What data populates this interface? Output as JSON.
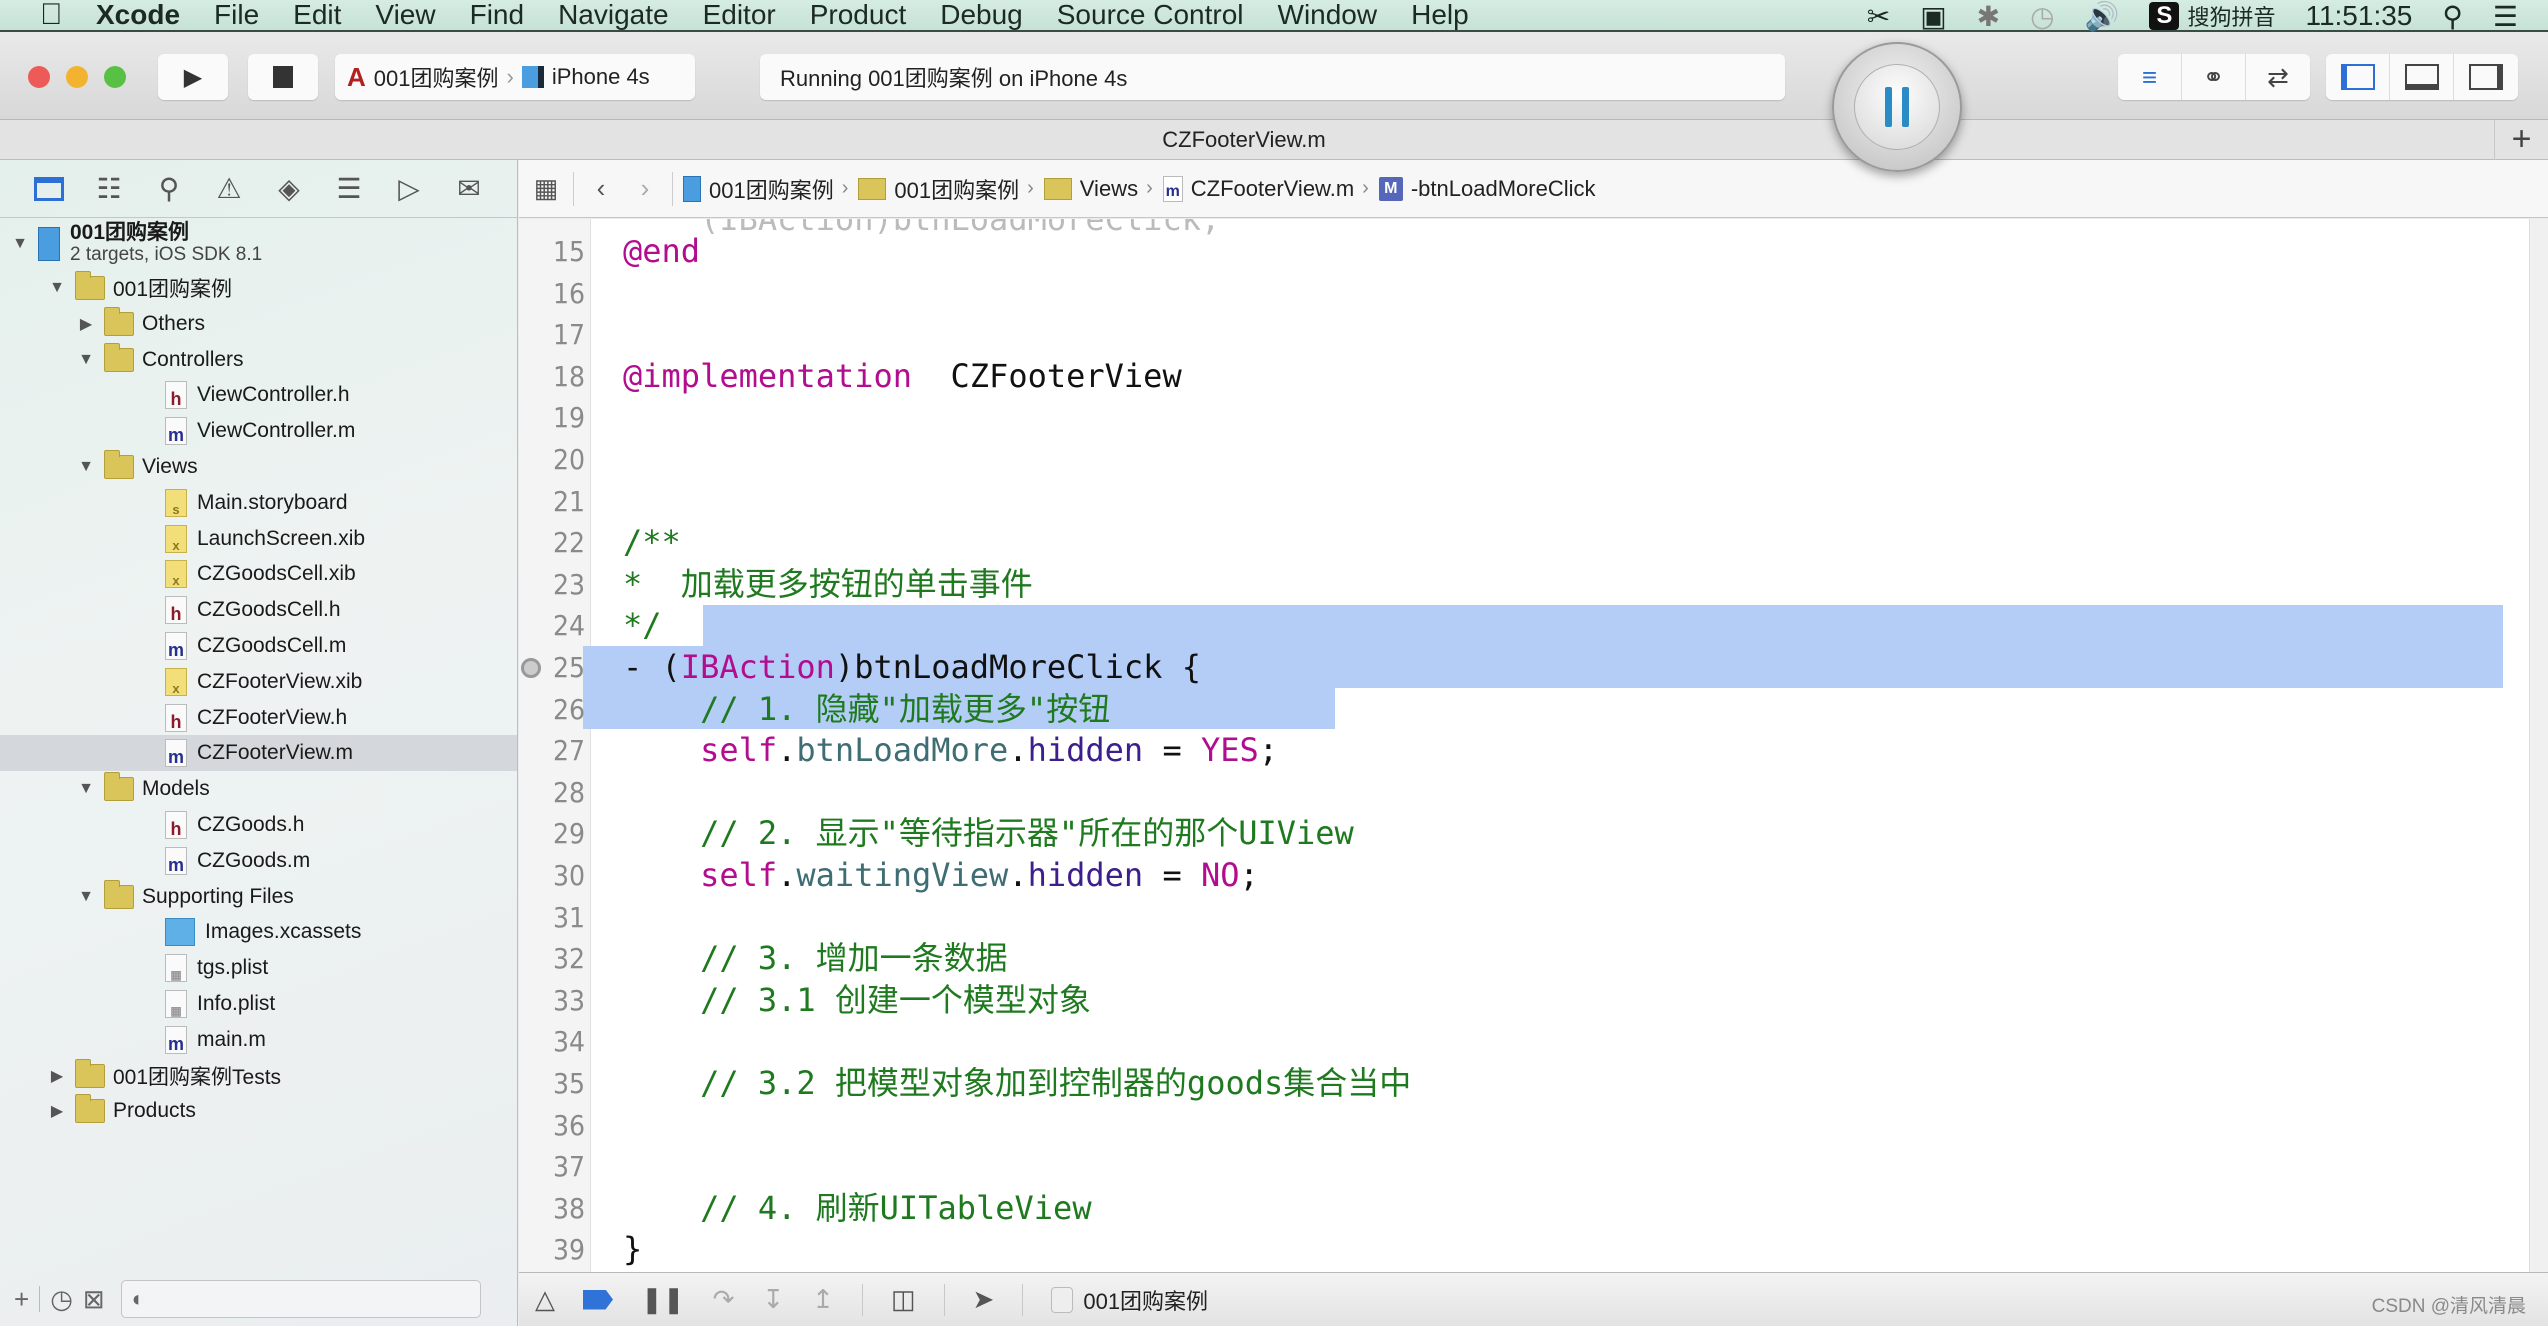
{
  "menubar": {
    "apple_icon": "apple-logo",
    "items": [
      "Xcode",
      "File",
      "Edit",
      "View",
      "Find",
      "Navigate",
      "Editor",
      "Product",
      "Debug",
      "Source Control",
      "Window",
      "Help"
    ],
    "status": {
      "input_method": "搜狗拼音",
      "input_badge": "S",
      "clock": "11:51:35"
    }
  },
  "toolbar": {
    "scheme_name": "001团购案例",
    "device": "iPhone 4s",
    "activity": "Running 001团购案例 on iPhone 4s"
  },
  "tab": {
    "title": "CZFooterView.m",
    "add_label": "+"
  },
  "navigator": {
    "project": {
      "name": "001团购案例",
      "subtitle": "2 targets, iOS SDK 8.1"
    },
    "items": [
      {
        "label": "001团购案例",
        "type": "folder",
        "depth": 1,
        "expanded": true
      },
      {
        "label": "Others",
        "type": "folder",
        "depth": 2,
        "expanded": false
      },
      {
        "label": "Controllers",
        "type": "folder",
        "depth": 2,
        "expanded": true
      },
      {
        "label": "ViewController.h",
        "type": "h",
        "depth": 3
      },
      {
        "label": "ViewController.m",
        "type": "m",
        "depth": 3
      },
      {
        "label": "Views",
        "type": "folder",
        "depth": 2,
        "expanded": true
      },
      {
        "label": "Main.storyboard",
        "type": "sb",
        "depth": 3
      },
      {
        "label": "LaunchScreen.xib",
        "type": "xib",
        "depth": 3
      },
      {
        "label": "CZGoodsCell.xib",
        "type": "xib",
        "depth": 3
      },
      {
        "label": "CZGoodsCell.h",
        "type": "h",
        "depth": 3
      },
      {
        "label": "CZGoodsCell.m",
        "type": "m",
        "depth": 3
      },
      {
        "label": "CZFooterView.xib",
        "type": "xib",
        "depth": 3
      },
      {
        "label": "CZFooterView.h",
        "type": "h",
        "depth": 3
      },
      {
        "label": "CZFooterView.m",
        "type": "m",
        "depth": 3,
        "selected": true
      },
      {
        "label": "Models",
        "type": "folder",
        "depth": 2,
        "expanded": true
      },
      {
        "label": "CZGoods.h",
        "type": "h",
        "depth": 3
      },
      {
        "label": "CZGoods.m",
        "type": "m",
        "depth": 3
      },
      {
        "label": "Supporting Files",
        "type": "folder",
        "depth": 2,
        "expanded": true
      },
      {
        "label": "Images.xcassets",
        "type": "assets",
        "depth": 3
      },
      {
        "label": "tgs.plist",
        "type": "plist",
        "depth": 3
      },
      {
        "label": "Info.plist",
        "type": "plist",
        "depth": 3
      },
      {
        "label": "main.m",
        "type": "m",
        "depth": 3
      },
      {
        "label": "001团购案例Tests",
        "type": "folder",
        "depth": 1,
        "expanded": false
      },
      {
        "label": "Products",
        "type": "folder",
        "depth": 1,
        "expanded": false
      }
    ],
    "filter_placeholder": ""
  },
  "jumpbar": {
    "crumbs": [
      "001团购案例",
      "001团购案例",
      "Views",
      "CZFooterView.m",
      "-btnLoadMoreClick"
    ]
  },
  "editor": {
    "lines": [
      {
        "n": "15",
        "tokens": [
          [
            "kw",
            "@end"
          ]
        ]
      },
      {
        "n": "16",
        "tokens": []
      },
      {
        "n": "17",
        "tokens": []
      },
      {
        "n": "18",
        "tokens": [
          [
            "kw",
            "@implementation"
          ],
          [
            "",
            "  CZFooterView"
          ]
        ]
      },
      {
        "n": "19",
        "tokens": []
      },
      {
        "n": "20",
        "tokens": []
      },
      {
        "n": "21",
        "tokens": []
      },
      {
        "n": "22",
        "tokens": [
          [
            "cm",
            "/**"
          ]
        ]
      },
      {
        "n": "23",
        "tokens": [
          [
            "cm",
            "*  加载更多按钮的单击事件"
          ]
        ]
      },
      {
        "n": "24",
        "tokens": [
          [
            "cm",
            "*/"
          ]
        ]
      },
      {
        "n": "25",
        "tokens": [
          [
            "",
            "- ("
          ],
          [
            "kw",
            "IBAction"
          ],
          [
            "",
            ")btnLoadMoreClick {"
          ]
        ],
        "breakpoint_marker": true
      },
      {
        "n": "26",
        "tokens": [
          [
            "cm",
            "    // 1. 隐藏\"加载更多\"按钮"
          ]
        ]
      },
      {
        "n": "27",
        "tokens": [
          [
            "kw",
            "    self"
          ],
          [
            "",
            "."
          ],
          [
            "prop",
            "btnLoadMore"
          ],
          [
            "",
            "."
          ],
          [
            "meth",
            "hidden"
          ],
          [
            "",
            " = "
          ],
          [
            "kw",
            "YES"
          ],
          [
            "",
            ";"
          ]
        ]
      },
      {
        "n": "28",
        "tokens": []
      },
      {
        "n": "29",
        "tokens": [
          [
            "cm",
            "    // 2. 显示\"等待指示器\"所在的那个UIView"
          ]
        ]
      },
      {
        "n": "30",
        "tokens": [
          [
            "kw",
            "    self"
          ],
          [
            "",
            "."
          ],
          [
            "prop",
            "waitingView"
          ],
          [
            "",
            "."
          ],
          [
            "meth",
            "hidden"
          ],
          [
            "",
            " = "
          ],
          [
            "kw",
            "NO"
          ],
          [
            "",
            ";"
          ]
        ]
      },
      {
        "n": "31",
        "tokens": []
      },
      {
        "n": "32",
        "tokens": [
          [
            "cm",
            "    // 3. 增加一条数据"
          ]
        ]
      },
      {
        "n": "33",
        "tokens": [
          [
            "cm",
            "    // 3.1 创建一个模型对象"
          ]
        ]
      },
      {
        "n": "34",
        "tokens": []
      },
      {
        "n": "35",
        "tokens": [
          [
            "cm",
            "    // 3.2 把模型对象加到控制器的goods集合当中"
          ]
        ]
      },
      {
        "n": "36",
        "tokens": []
      },
      {
        "n": "37",
        "tokens": []
      },
      {
        "n": "38",
        "tokens": [
          [
            "cm",
            "    // 4. 刷新UITableView"
          ]
        ]
      },
      {
        "n": "39",
        "tokens": [
          [
            "",
            "}"
          ]
        ]
      }
    ],
    "selection": {
      "from_line": "33",
      "from_after_text": "// 3.",
      "to_line": "35",
      "to_before_text": "集合当中"
    }
  },
  "debugbar": {
    "target": "001团购案例"
  },
  "watermark": "CSDN @清风清晨",
  "colors": {
    "keyword": "#b20d8f",
    "comment": "#1f7a1f",
    "selection": "#b3cdf7",
    "accent": "#2d6fd6"
  }
}
